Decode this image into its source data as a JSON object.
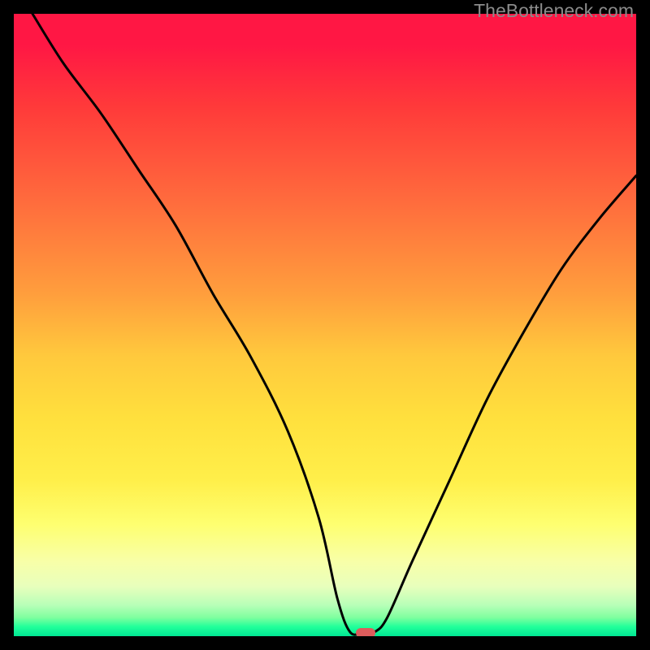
{
  "watermark": "TheBottleneck.com",
  "chart_data": {
    "type": "line",
    "title": "",
    "xlabel": "",
    "ylabel": "",
    "xlim": [
      0,
      100
    ],
    "ylim": [
      0,
      100
    ],
    "grid": false,
    "legend": false,
    "series": [
      {
        "name": "bottleneck-curve",
        "x": [
          3,
          8,
          14,
          20,
          26,
          32,
          38,
          44,
          49,
          52,
          54,
          56,
          58,
          60,
          64,
          70,
          76,
          82,
          88,
          94,
          100
        ],
        "y": [
          100,
          92,
          84,
          75,
          66,
          55,
          45,
          33,
          19,
          6,
          0.7,
          0.5,
          0.7,
          3,
          12,
          25,
          38,
          49,
          59,
          67,
          74
        ]
      }
    ],
    "marker": {
      "x": 56.5,
      "y": 0.5,
      "color": "#dd5c5c"
    },
    "gradient_stops": [
      {
        "pct": 0,
        "color": "#ff1744"
      },
      {
        "pct": 15,
        "color": "#ff3a3a"
      },
      {
        "pct": 30,
        "color": "#ff6b3d"
      },
      {
        "pct": 45,
        "color": "#ff9e3d"
      },
      {
        "pct": 60,
        "color": "#ffe03d"
      },
      {
        "pct": 80,
        "color": "#feff70"
      },
      {
        "pct": 92,
        "color": "#e8ffbc"
      },
      {
        "pct": 100,
        "color": "#00e693"
      }
    ]
  }
}
